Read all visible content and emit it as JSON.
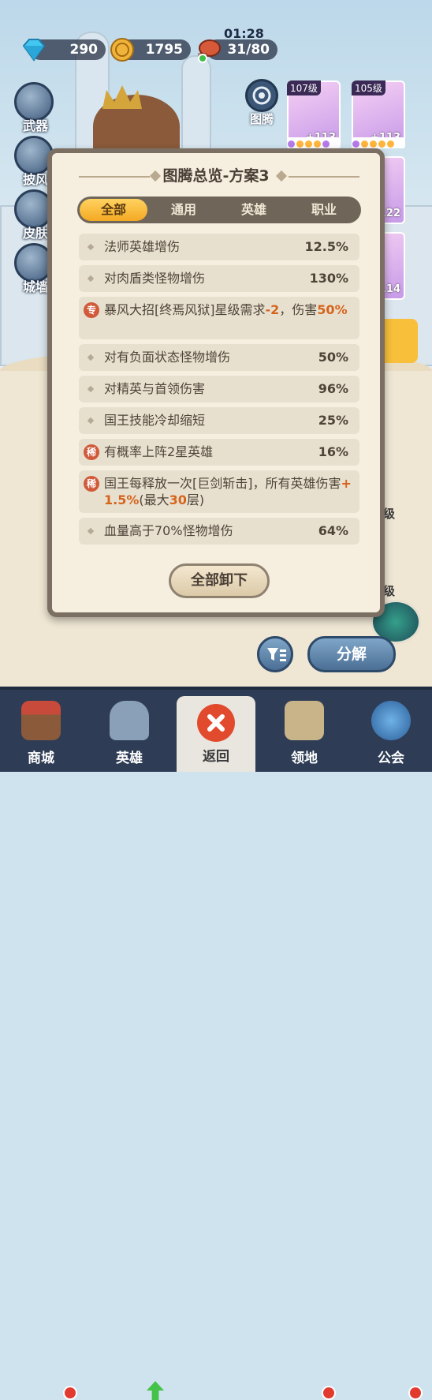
{
  "hud": {
    "gems": "290",
    "coins": "1795",
    "timer": "01:28",
    "stamina": "31/80"
  },
  "left_menu": [
    {
      "label": "武器"
    },
    {
      "label": "披风"
    },
    {
      "label": "皮肤"
    },
    {
      "label": "城墙"
    }
  ],
  "totem": {
    "label": "图腾",
    "cards": [
      {
        "level": "107级",
        "bonus": "+113"
      },
      {
        "level": "105级",
        "bonus": "+113"
      },
      {
        "level": "",
        "bonus": "+122"
      },
      {
        "level": "",
        "bonus": "+114"
      }
    ]
  },
  "modal": {
    "title": "图腾总览-方案3",
    "tabs": [
      "全部",
      "通用",
      "英雄",
      "职业"
    ],
    "active_tab": "全部",
    "rows": [
      {
        "text": "法师英雄增伤",
        "value": "12.5%"
      },
      {
        "text": "对肉盾类怪物增伤",
        "value": "130%"
      },
      {
        "badge": "专",
        "text_a": "暴风大招[终焉风狱]星级需求",
        "hl_a": "-2",
        "text_b": "，伤害",
        "hl_b": "50%"
      },
      {
        "text": "对有负面状态怪物增伤",
        "value": "50%"
      },
      {
        "text": "对精英与首领伤害",
        "value": "96%"
      },
      {
        "text": "国王技能冷却缩短",
        "value": "25%"
      },
      {
        "badge": "稀",
        "text": "有概率上阵2星英雄",
        "value": "16%"
      },
      {
        "badge": "稀",
        "text_a": "国王每释放一次[巨剑斩击]，所有英雄伤害",
        "hl_a": "+",
        "hl_b": "1.5%",
        "text_b": "(最大",
        "hl_c": "30",
        "text_c": "层)"
      },
      {
        "text": "血量高于70%怪物增伤",
        "value": "64%"
      }
    ],
    "unequip_all": "全部卸下"
  },
  "background": {
    "side_labels": [
      "级",
      "级"
    ],
    "decompose_button": "分解"
  },
  "nav": [
    {
      "label": "商城"
    },
    {
      "label": "英雄"
    },
    {
      "label": "返回"
    },
    {
      "label": "领地"
    },
    {
      "label": "公会"
    }
  ]
}
